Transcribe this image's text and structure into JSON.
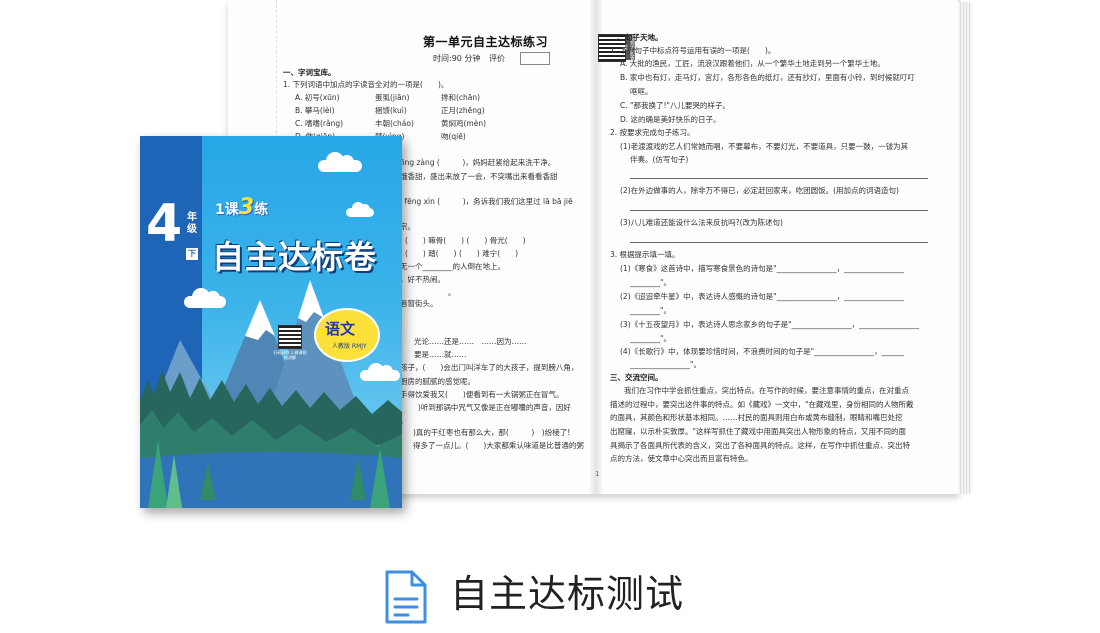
{
  "exercise": {
    "title": "第一单元自主达标练习",
    "time_label": "时间:90 分钟",
    "eval_label": "评价",
    "qr_tag": "视频讲解答案",
    "page_number": "1"
  },
  "left_page": {
    "section1": "一、字词宝库。",
    "q1": "1. 下列词语中加点的字读音全对的一项是(　　)。",
    "q1_options": [
      {
        "a": "A. 初号(xūn)",
        "b": "蛋虱(jiān)",
        "c": "搀和(chān)"
      },
      {
        "a": "B. 攀马(lèi)",
        "b": "捆馈(kuì)",
        "c": "正月(zhēng)"
      },
      {
        "a": "C. 嗜嗜(rǎng)",
        "b": "丰朝(cháo)",
        "c": "黄焖鸡(mèn)"
      },
      {
        "a": "D. 做(qiān)",
        "b": "梦(yìng)",
        "c": "吻(qiē)"
      }
    ],
    "lines": [
      "ōng zàng (　　　)，妈妈赶紧给起来洗干净。",
      "饿香甜，盛出来放了一会，不突嘴出来看看香甜",
      "ǐ fēng xìn (　　　)，务诉我们我们这里过 lā bā jiē",
      "宗。",
      "(　　) 嘛骨(　　) (　　) 骨光(　　)",
      "(　　) 踏(　　) (　　) 难宁(　　)",
      "无一个________的人倒在地上。",
      "，好不热闹。",
      "。",
      "唇窗街头。",
      "光论……还是……　……因为……",
      "要是……就……",
      "孩子，(　　)会出门叫洋车了的大孩子，提到膀八角，",
      "厨房的腻腻的感觉呢。",
      "手得饮爱我又(　　)便看到有一大锅粥正在冒气。",
      "(　　)听到那锅中咒气又像是正在嘟囔的声音，因好",
      "。",
      ")真的干红枣也有那么大，那(　　　)　)纷棱了!",
      "得多了一点儿。(　　)大家都乘认味道是比普通的粥"
    ]
  },
  "right_page": {
    "section2": "二、句子天地。",
    "q1": "1. 下列句子中标点符号运用有误的一项是(　　)。",
    "q1_options": [
      "A. 大批的渔民，工匠，流浪汉跟着他们，从一个繁华土地走到另一个繁华土地。",
      "B. 家中也有灯，走马灯，宫灯，各形各色的纸灯，还有抄灯，里面有小铃，到时候就叮叮",
      "哐哐。",
      "C. \"那我换了!\"八儿要哭的样子。",
      "D. 这的确是美好快乐的日子。"
    ],
    "q2": "2. 按要求完成句子练习。",
    "q2_items": [
      "(1)老渡渡戏的艺人们常她而唱，不要幕布，不要灯光，不要道具，只要一鼓，一钹为其",
      "伴奏。(仿写句子)",
      "(2)在外边做事的人，除非万不得已，必定赶回家来，吃团圆饭。(用加点的词语造句)",
      "(3)八儿难道还能设什么法来反抗吗?(改为陈述句)"
    ],
    "q3": "3. 根据提示填一填。",
    "q3_items": [
      "(1)《寒食》这首诗中，描写寒食景色的诗句是\"________________，________________",
      "________\"。",
      "(2)《迢迢牵牛星》中，表达诗人感慨的诗句是\"________________，________________",
      "________\"。",
      "(3)《十五夜望月》中，表达诗人思念家乡的句子是\"________________，________________",
      "________\"。",
      "(4)《长歌行》中，体现要珍惜时间，不浪费时间的句子是\"________________，______",
      "________________\"。"
    ],
    "section3": "三、交流空间。",
    "paragraph": [
      "我们在习作中学会抓住重点，突出特点。在写作的时候，要注意事情的重点，在对重点",
      "描述的过程中，要突出这件事的特点。如《藏戏》一文中，\"在藏戏里，身份相同的人物所戴",
      "的面具，其颜色和形状基本相同。……村民的面具则用白布或黄布缝制，眼睛和嘴巴处挖",
      "出窟窿，以示朴实敦厚。\"这样写抓住了藏戏中用面具突出人物形象的特点，又用不同的面",
      "具揭示了各面具所代表的含义，突出了各种面具的特点。这样，在写作中抓住重点、突出特",
      "点的方法，使文章中心突出而且富有特色。"
    ]
  },
  "cover": {
    "series_prefix": "1课",
    "series_num": "3",
    "series_suffix": "练",
    "grade_num": "4",
    "grade_label": "年级",
    "volume": "下",
    "title": "自主达标卷",
    "subject": "语文",
    "edition": "人教版 RMJY",
    "qr_caption": "扫码获取 1.微课视频讲解"
  },
  "caption": {
    "text": "自主达标测试",
    "icon": "document-icon"
  },
  "colors": {
    "cover_sky": "#3bb3ea",
    "cover_side": "#1e64b7",
    "subject_circle": "#fde13a",
    "icon_blue": "#3d8fe0"
  }
}
